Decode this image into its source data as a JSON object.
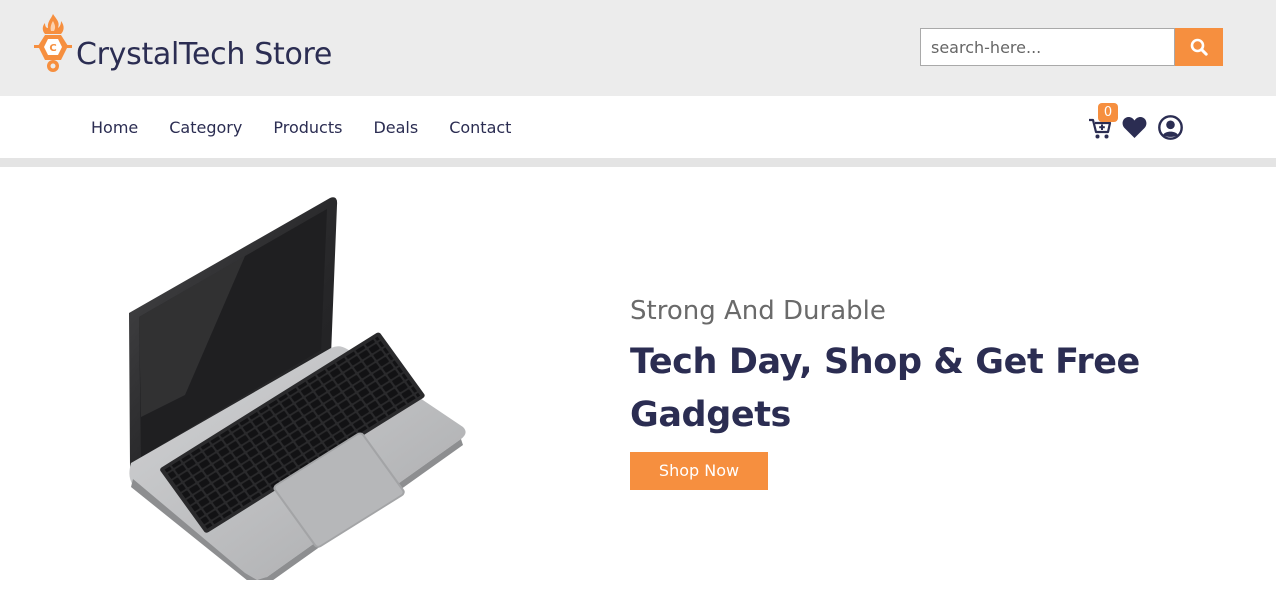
{
  "brand": {
    "name": "CrystalTech Store",
    "logo_letter": "C",
    "logo_icon": "flame-crystal-logo",
    "accent_color": "#f68f3f",
    "text_color": "#2b2d52"
  },
  "search": {
    "placeholder": "search-here...",
    "value": "",
    "button_icon": "search-icon"
  },
  "nav": {
    "items": [
      {
        "label": "Home"
      },
      {
        "label": "Category"
      },
      {
        "label": "Products"
      },
      {
        "label": "Deals"
      },
      {
        "label": "Contact"
      }
    ]
  },
  "header_icons": {
    "cart_icon": "cart-plus-icon",
    "cart_count": "0",
    "wishlist_icon": "heart-icon",
    "account_icon": "user-circle-icon"
  },
  "hero": {
    "subtitle": "Strong And Durable",
    "title": "Tech Day, Shop & Get Free Gadgets",
    "cta_label": "Shop Now",
    "image": "laptop-image"
  }
}
